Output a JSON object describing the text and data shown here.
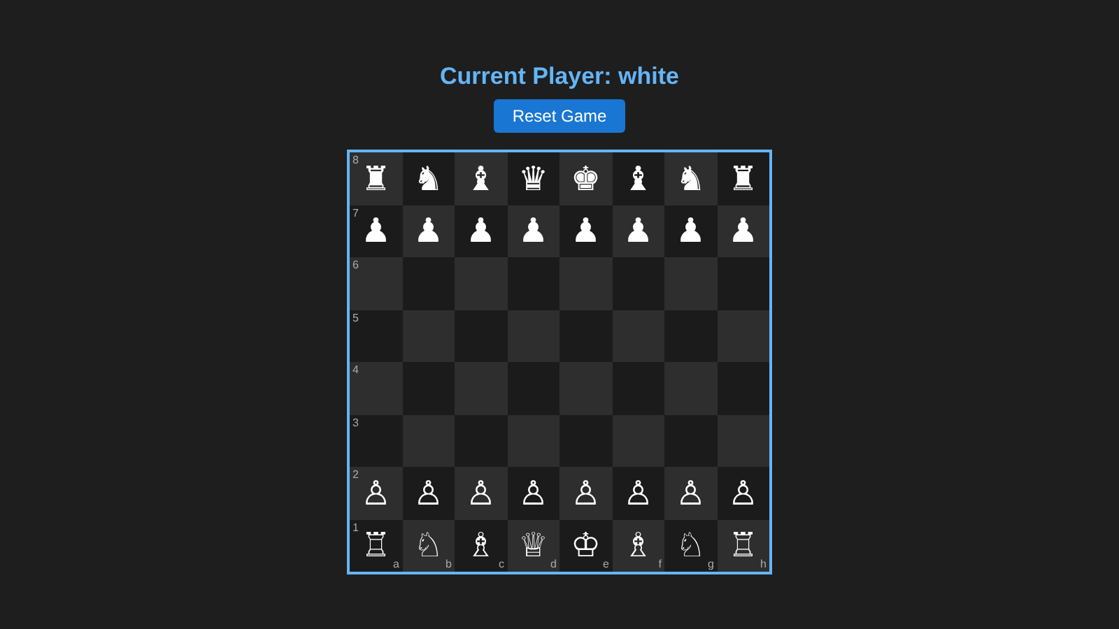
{
  "title": "Current Player: white",
  "reset_button": "Reset Game",
  "board": [
    {
      "rank": "8",
      "squares": [
        {
          "kind": "piece",
          "piece": "♜"
        },
        {
          "kind": "piece",
          "piece": "♞"
        },
        {
          "kind": "piece",
          "piece": "♝"
        },
        {
          "kind": "piece",
          "piece": "♛"
        },
        {
          "kind": "piece",
          "piece": "♚"
        },
        {
          "kind": "piece",
          "piece": "♝"
        },
        {
          "kind": "piece",
          "piece": "♞"
        },
        {
          "kind": "piece",
          "piece": "♜"
        }
      ]
    },
    {
      "rank": "7",
      "squares": [
        {
          "kind": "piece",
          "piece": "♟"
        },
        {
          "kind": "piece",
          "piece": "♟"
        },
        {
          "kind": "piece",
          "piece": "♟"
        },
        {
          "kind": "piece",
          "piece": "♟"
        },
        {
          "kind": "piece",
          "piece": "♟"
        },
        {
          "kind": "piece",
          "piece": "♟"
        },
        {
          "kind": "piece",
          "piece": "♟"
        },
        {
          "kind": "piece",
          "piece": "♟"
        }
      ]
    },
    {
      "rank": "6",
      "squares": [
        {
          "kind": "empty"
        },
        {
          "kind": "empty"
        },
        {
          "kind": "empty"
        },
        {
          "kind": "empty"
        },
        {
          "kind": "empty"
        },
        {
          "kind": "empty"
        },
        {
          "kind": "empty"
        },
        {
          "kind": "empty"
        }
      ]
    },
    {
      "rank": "5",
      "squares": [
        {
          "kind": "empty"
        },
        {
          "kind": "empty"
        },
        {
          "kind": "empty"
        },
        {
          "kind": "empty"
        },
        {
          "kind": "empty"
        },
        {
          "kind": "empty"
        },
        {
          "kind": "empty"
        },
        {
          "kind": "empty"
        }
      ]
    },
    {
      "rank": "4",
      "squares": [
        {
          "kind": "empty"
        },
        {
          "kind": "empty"
        },
        {
          "kind": "empty"
        },
        {
          "kind": "empty"
        },
        {
          "kind": "empty"
        },
        {
          "kind": "empty"
        },
        {
          "kind": "empty"
        },
        {
          "kind": "empty"
        }
      ]
    },
    {
      "rank": "3",
      "squares": [
        {
          "kind": "empty"
        },
        {
          "kind": "empty"
        },
        {
          "kind": "empty"
        },
        {
          "kind": "empty"
        },
        {
          "kind": "empty"
        },
        {
          "kind": "empty"
        },
        {
          "kind": "empty"
        },
        {
          "kind": "empty"
        }
      ]
    },
    {
      "rank": "2",
      "squares": [
        {
          "kind": "piece",
          "piece": "♙"
        },
        {
          "kind": "piece",
          "piece": "♙"
        },
        {
          "kind": "piece",
          "piece": "♙"
        },
        {
          "kind": "piece",
          "piece": "♙"
        },
        {
          "kind": "piece",
          "piece": "♙"
        },
        {
          "kind": "piece",
          "piece": "♙"
        },
        {
          "kind": "piece",
          "piece": "♙"
        },
        {
          "kind": "piece",
          "piece": "♙"
        }
      ]
    },
    {
      "rank": "1",
      "squares": [
        {
          "kind": "piece",
          "piece": "♖",
          "file": "a"
        },
        {
          "kind": "piece",
          "piece": "♘",
          "file": "b"
        },
        {
          "kind": "piece",
          "piece": "♗",
          "file": "c"
        },
        {
          "kind": "piece",
          "piece": "♕",
          "file": "d"
        },
        {
          "kind": "piece",
          "piece": "♔",
          "file": "e"
        },
        {
          "kind": "piece",
          "piece": "♗",
          "file": "f"
        },
        {
          "kind": "piece",
          "piece": "♘",
          "file": "g"
        },
        {
          "kind": "piece",
          "piece": "♖",
          "file": "h"
        }
      ]
    }
  ]
}
